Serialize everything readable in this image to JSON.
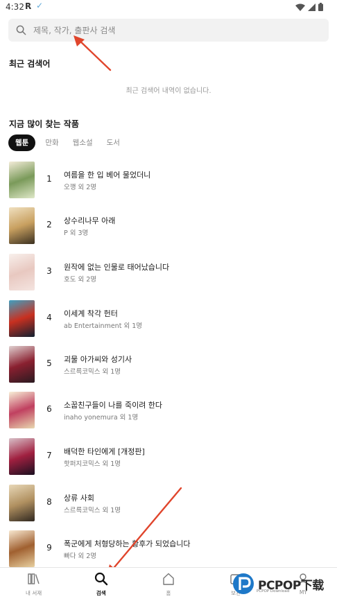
{
  "status_bar": {
    "time": "4:32",
    "app_letter": "R"
  },
  "search": {
    "placeholder": "제목, 작가, 출판사 검색",
    "value": ""
  },
  "recent": {
    "title": "최근 검색어",
    "empty_text": "최근 검색어 내역이 없습니다."
  },
  "popular": {
    "title": "지금 많이 찾는 작품",
    "tabs": [
      {
        "label": "웹툰",
        "active": true
      },
      {
        "label": "만화",
        "active": false
      },
      {
        "label": "웹소설",
        "active": false
      },
      {
        "label": "도서",
        "active": false
      }
    ],
    "items": [
      {
        "rank": "1",
        "title": "여름을 한 입 베어 물었더니",
        "author": "오깽 외 2명",
        "cover_colors": [
          "#dfe8c8",
          "#7a9a5a",
          "#f3ecd8"
        ]
      },
      {
        "rank": "2",
        "title": "상수리나무 아래",
        "author": "P 외 3명",
        "cover_colors": [
          "#3a3020",
          "#c8a060",
          "#f0e0c0"
        ]
      },
      {
        "rank": "3",
        "title": "원작에 없는 인물로 태어났습니다",
        "author": "호도 외 2명",
        "cover_colors": [
          "#f4e4e0",
          "#e8c8c0",
          "#f8f0ec"
        ]
      },
      {
        "rank": "4",
        "title": "이세계 착각 헌터",
        "author": "ab Entertainment 외 1명",
        "cover_colors": [
          "#102030",
          "#c83020",
          "#40a0c0"
        ]
      },
      {
        "rank": "5",
        "title": "괴물 아가씨와 성기사",
        "author": "스르륵코믹스 외 1명",
        "cover_colors": [
          "#2a1a20",
          "#8a2030",
          "#e0d0d0"
        ]
      },
      {
        "rank": "6",
        "title": "소꿉친구들이 나를 죽이려 한다",
        "author": "inaho yonemura 외 1명",
        "cover_colors": [
          "#e8d8b0",
          "#c04060",
          "#f8f0d8"
        ]
      },
      {
        "rank": "7",
        "title": "배덕한 타인에게 [개정판]",
        "author": "핫퍼지코믹스 외 1명",
        "cover_colors": [
          "#1a1020",
          "#a02040",
          "#d8c0c8"
        ]
      },
      {
        "rank": "8",
        "title": "상류 사회",
        "author": "스르륵코믹스 외 1명",
        "cover_colors": [
          "#302820",
          "#b09060",
          "#e8d8b8"
        ]
      },
      {
        "rank": "9",
        "title": "폭군에게 처형당하는 황후가 되었습니다",
        "author": "빠다 외 2명",
        "cover_colors": [
          "#e8d0a0",
          "#a06030",
          "#f8e8d0"
        ]
      }
    ]
  },
  "bottom_nav": [
    {
      "label": "내 서재",
      "icon": "bookshelf-icon",
      "active": false
    },
    {
      "label": "검색",
      "icon": "search-icon",
      "active": true
    },
    {
      "label": "홈",
      "icon": "home-icon",
      "active": false
    },
    {
      "label": "보관",
      "icon": "box-icon",
      "active": false
    },
    {
      "label": "MY",
      "icon": "user-icon",
      "active": false
    }
  ],
  "watermark": {
    "text": "PCPOP下载",
    "sub": "PCPOP Download"
  },
  "colors": {
    "arrow": "#e0452c",
    "active_tab_bg": "#111111",
    "search_bg": "#f2f2f2"
  }
}
